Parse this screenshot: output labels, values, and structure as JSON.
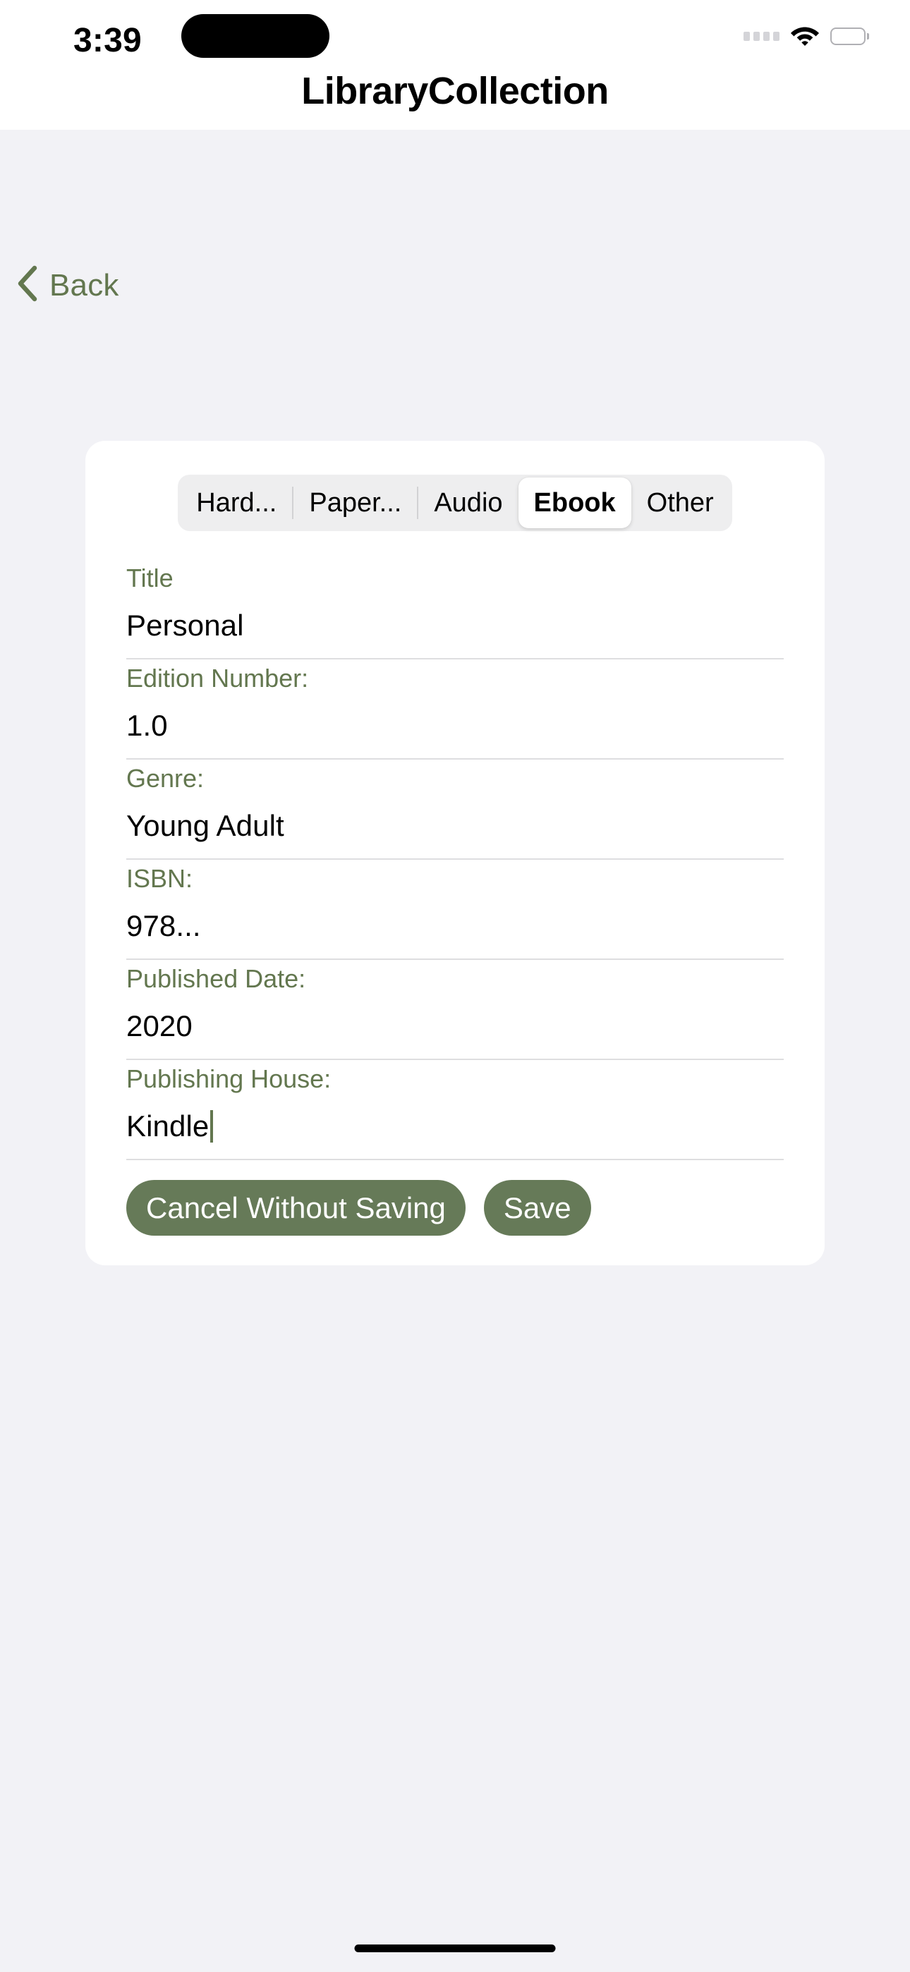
{
  "status_bar": {
    "time": "3:39",
    "signal_icon": "signal-dots-icon",
    "wifi_icon": "wifi-icon",
    "battery_icon": "battery-icon"
  },
  "header": {
    "title": "LibraryCollection"
  },
  "nav": {
    "back_label": "Back",
    "back_icon": "chevron-left-icon"
  },
  "segmented_control": {
    "options": [
      {
        "label": "Hard...",
        "selected": false
      },
      {
        "label": "Paper...",
        "selected": false
      },
      {
        "label": "Audio",
        "selected": false
      },
      {
        "label": "Ebook",
        "selected": true
      },
      {
        "label": "Other",
        "selected": false
      }
    ],
    "selected_value": "Ebook"
  },
  "form": {
    "fields": [
      {
        "label": "Title",
        "value": "Personal",
        "focused": false
      },
      {
        "label": "Edition Number:",
        "value": "1.0",
        "focused": false
      },
      {
        "label": "Genre:",
        "value": "Young Adult",
        "focused": false
      },
      {
        "label": "ISBN:",
        "value": "978...",
        "focused": false
      },
      {
        "label": "Published Date:",
        "value": "2020",
        "focused": false
      },
      {
        "label": "Publishing House:",
        "value": "Kindle",
        "focused": true
      }
    ]
  },
  "actions": {
    "cancel_label": "Cancel Without Saving",
    "save_label": "Save"
  },
  "colors": {
    "accent_green": "#667a58",
    "label_green": "#63774f",
    "page_background": "#f2f2f6",
    "card_background": "#ffffff",
    "segment_track": "#eeeeef"
  }
}
